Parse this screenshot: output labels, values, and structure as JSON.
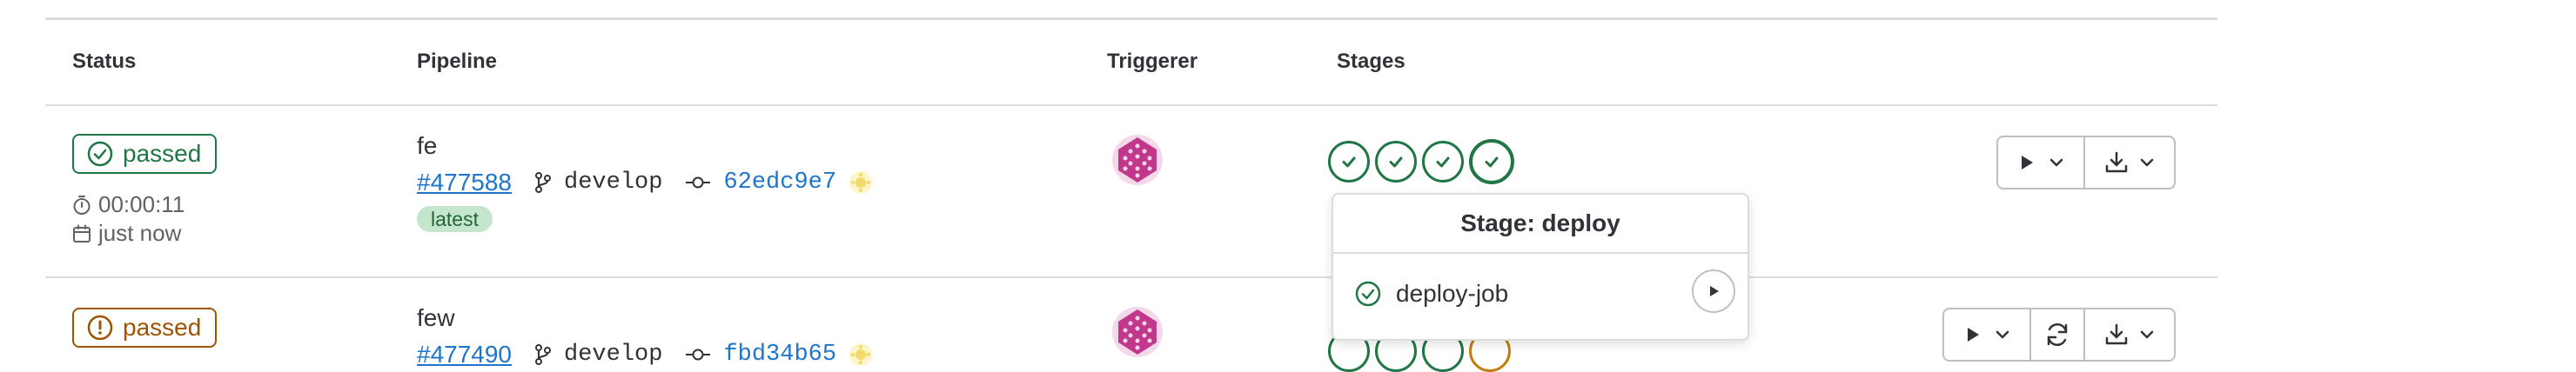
{
  "table": {
    "headers": {
      "status": "Status",
      "pipeline": "Pipeline",
      "triggerer": "Triggerer",
      "stages": "Stages"
    }
  },
  "rows": [
    {
      "status": "passed",
      "duration": "00:00:11",
      "finished": "just now",
      "name": "fe",
      "id": "#477588",
      "ref": "develop",
      "commit": "62edc9e7",
      "badge": "latest",
      "stages": [
        "success",
        "success",
        "success",
        "success"
      ]
    },
    {
      "status": "passed",
      "name": "few",
      "id": "#477490",
      "ref": "develop",
      "commit": "fbd34b65",
      "stages": [
        "success",
        "success",
        "success",
        "warning"
      ]
    }
  ],
  "popover": {
    "title": "Stage: deploy",
    "job": "deploy-job"
  },
  "colors": {
    "success": "#217645",
    "warning": "#9e5400",
    "link": "#1f75cb",
    "latest_bg": "#c3e6cd",
    "avatar": "#c0378c"
  },
  "icons": [
    "status-success-icon",
    "status-warning-icon",
    "timer-icon",
    "calendar-icon",
    "branch-icon",
    "commit-icon",
    "play-icon",
    "chevron-down-icon",
    "retry-icon",
    "download-icon"
  ]
}
